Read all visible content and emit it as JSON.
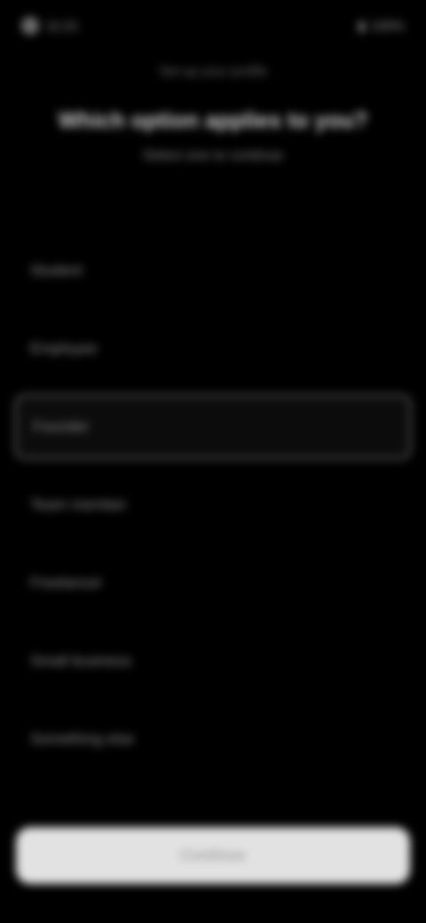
{
  "status_bar": {
    "time": "11:21",
    "battery": "100%"
  },
  "header": {
    "eyebrow": "Set up your profile",
    "title": "Which option applies to you?",
    "subtitle": "Select one to continue"
  },
  "options": [
    {
      "label": "Student"
    },
    {
      "label": "Employee"
    },
    {
      "label": "Founder"
    },
    {
      "label": "Team member"
    },
    {
      "label": "Freelancer"
    },
    {
      "label": "Small business"
    },
    {
      "label": "Something else"
    }
  ],
  "selected_index": 2,
  "continue_button": {
    "label": "Continue"
  },
  "colors": {
    "background": "#000000",
    "button": "#e2e2e2",
    "selected_border": "#555555"
  }
}
